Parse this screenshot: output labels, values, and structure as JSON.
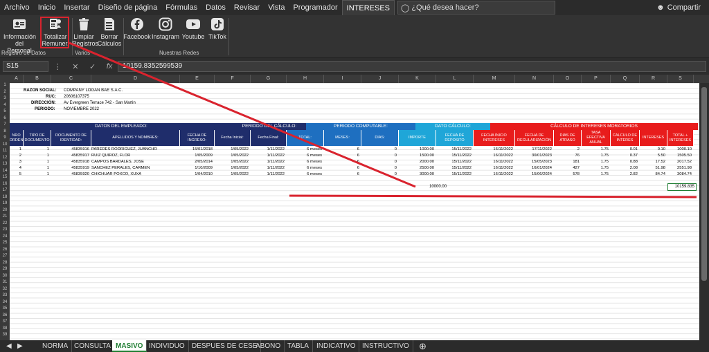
{
  "menu": {
    "tabs": [
      "Archivo",
      "Inicio",
      "Insertar",
      "Diseño de página",
      "Fórmulas",
      "Datos",
      "Revisar",
      "Vista",
      "Programador",
      "INTERESES"
    ],
    "active_tab": "INTERESES",
    "tell_me": "¿Qué desea hacer?",
    "share": "Compartir"
  },
  "ribbon": {
    "info_personal": "Información del Personal",
    "totalizar": "Totalizar Remuner.",
    "limpiar": "Limpiar Registros",
    "borrar": "Borrar Cálculos",
    "facebook": "Facebook",
    "instagram": "Instagram",
    "youtube": "Youtube",
    "tiktok": "TikTok",
    "group_registro": "Registro de Datos",
    "group_varios": "Varios",
    "group_redes": "Nuestras Redes"
  },
  "formula_bar": {
    "name_box": "S15",
    "formula": "10159.8352599539"
  },
  "columns": [
    "A",
    "B",
    "C",
    "D",
    "E",
    "F",
    "G",
    "H",
    "I",
    "J",
    "K",
    "L",
    "M",
    "N",
    "O",
    "P",
    "Q",
    "R",
    "S"
  ],
  "rows": [
    "1",
    "2",
    "3",
    "4",
    "5",
    "6",
    "7",
    "8",
    "9",
    "10",
    "11",
    "12",
    "13",
    "14",
    "15",
    "16",
    "17",
    "18",
    "19",
    "20",
    "21",
    "22",
    "23",
    "24",
    "25",
    "26",
    "27",
    "28",
    "29",
    "30",
    "31",
    "32",
    "33",
    "34",
    "35",
    "36",
    "37",
    "38",
    "39"
  ],
  "company": {
    "razon_label": "RAZON SOCIAL:",
    "razon": "COMPANY LOGAN BAE S.A.C.",
    "ruc_label": "RUC:",
    "ruc": "20606107375",
    "dir_label": "DIRECCIÓN:",
    "dir": "Av Evergreen Terrace 742 - San Martin",
    "periodo_label": "PERIODO:",
    "periodo": "NOVIEMBRE 2022"
  },
  "bands": {
    "empleado": "DATOS DEL EMPLEADO:",
    "periodo_calculo": "PERIODO DEL CÁLCULO:",
    "periodo_computable": "PERIODO COMPUTABLE:",
    "dato_calculo": "DATO CÁLCULO:",
    "intereses": "CÁLCULO DE INTERESES MORATORIOS"
  },
  "headers": [
    "NRO ORDEN",
    "TIPO DE DOCUMENTO",
    "DOCUMENTO DE IDENTIDAD:",
    "APELLIDOS Y NOMBRES:",
    "FECHA DE INGRESO:",
    "Fecha Inicial:",
    "Fecha Final:",
    "TOTAL:",
    "MESES:",
    "DIAS:",
    "IMPORTE",
    "FECHA DE DEPOSITO",
    "FECHA INICIO INTERESES",
    "FECHA DE REGULARIZACIÓN",
    "DIAS DE ATRASO",
    "TASA EFECTIVA ANUAL",
    "CALCULO DE INTERES",
    "INTERESES",
    "TOTAL + INTERESES"
  ],
  "table": [
    [
      "1",
      "1",
      "45835916",
      "PAREDES RODRIGUEZ, JUANCHO",
      "15/01/2018",
      "1/05/2022",
      "1/11/2022",
      "6 meses",
      "6",
      "0",
      "1000.00",
      "15/11/2022",
      "16/11/2022",
      "17/11/2022",
      "2",
      "1.75",
      "0.01",
      "0.10",
      "1000.10"
    ],
    [
      "2",
      "1",
      "45835917",
      "RUIZ QUIROZ, FLOR",
      "1/05/2009",
      "1/05/2022",
      "1/11/2022",
      "6 meses",
      "6",
      "0",
      "1500.00",
      "15/11/2022",
      "16/11/2022",
      "30/01/2023",
      "76",
      "1.75",
      "0.37",
      "5.50",
      "1505.50"
    ],
    [
      "3",
      "1",
      "45835918",
      "CAMPOS BARDALES, JOSE",
      "2/05/2014",
      "1/05/2022",
      "1/11/2022",
      "6 meses",
      "6",
      "0",
      "2000.00",
      "15/11/2022",
      "16/11/2022",
      "15/05/2023",
      "181",
      "1.75",
      "0.88",
      "17.52",
      "2017.52"
    ],
    [
      "4",
      "1",
      "45835919",
      "SANCHEZ PERALES, CARMEN",
      "1/10/2009",
      "1/05/2022",
      "1/11/2022",
      "6 meses",
      "6",
      "0",
      "2500.00",
      "15/11/2022",
      "16/11/2022",
      "16/01/2024",
      "427",
      "1.75",
      "2.08",
      "51.98",
      "2551.98"
    ],
    [
      "5",
      "1",
      "45835920",
      "CHICHUAR POXCO, XUXA",
      "1/04/2010",
      "1/05/2022",
      "1/11/2022",
      "6 meses",
      "6",
      "0",
      "3000.00",
      "15/11/2022",
      "16/11/2022",
      "15/06/2024",
      "578",
      "1.75",
      "2.82",
      "84.74",
      "3084.74"
    ]
  ],
  "totals": {
    "importe": "10000.00",
    "total": "10159.835"
  },
  "sheets": [
    "NORMA",
    "CONSULTA",
    "MASIVO",
    "INDIVIDUO",
    "DESPUES DE CESE",
    "ABONO",
    "TABLA",
    "INDICATIVO",
    "INSTRUCTIVO"
  ],
  "active_sheet": "MASIVO",
  "colors": {
    "navy": "#1f2d6b",
    "blue": "#1e6fc0",
    "cyan": "#1fa6d8",
    "red": "#e81c1c",
    "annotation": "#d9232e",
    "excel_green": "#1e7d32"
  }
}
